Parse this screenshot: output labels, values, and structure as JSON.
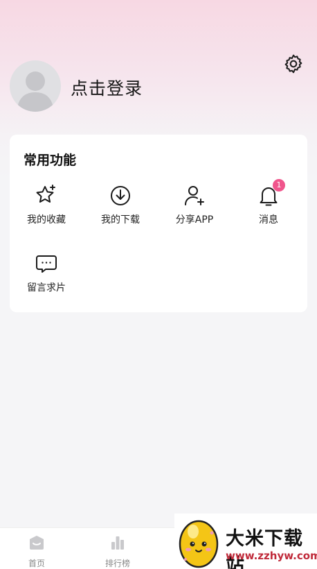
{
  "profile": {
    "login_text": "点击登录"
  },
  "common_functions": {
    "title": "常用功能",
    "items": [
      {
        "label": "我的收藏",
        "icon": "star-icon"
      },
      {
        "label": "我的下载",
        "icon": "download-icon"
      },
      {
        "label": "分享APP",
        "icon": "add-user-icon"
      },
      {
        "label": "消息",
        "icon": "bell-icon",
        "badge": "1"
      },
      {
        "label": "留言求片",
        "icon": "chat-icon"
      }
    ]
  },
  "tabbar": {
    "items": [
      {
        "label": "首页",
        "icon": "home-icon"
      },
      {
        "label": "排行榜",
        "icon": "bar-chart-icon"
      }
    ]
  },
  "watermark": {
    "title": "大米下载站",
    "url": "www.zzhyw.com"
  },
  "colors": {
    "accent_pink": "#f0558c",
    "header_gradient_top": "#f7d8e3",
    "background": "#f5f5f7"
  }
}
